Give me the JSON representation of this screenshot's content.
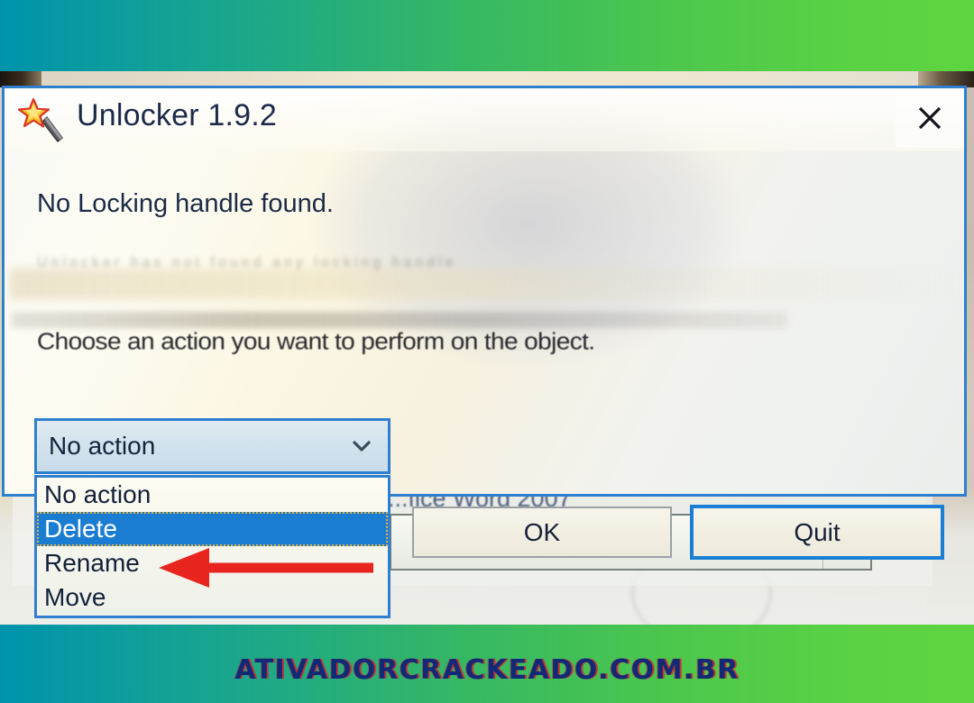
{
  "window": {
    "title": "Unlocker 1.9.2",
    "icon": "magic-wand-icon",
    "close_label": "✕",
    "accent_color": "#2f7fd0"
  },
  "messages": {
    "primary": "No Locking handle found.",
    "ghost_line": "Unlocker has not found any locking handle",
    "instruction": "Choose an action you want to perform on the object."
  },
  "action_combo": {
    "selected": "No action",
    "chevron": "chevron-down-icon",
    "options": [
      {
        "label": "No action",
        "state": "normal"
      },
      {
        "label": "Delete",
        "state": "highlighted"
      },
      {
        "label": "Rename",
        "state": "normal"
      },
      {
        "label": "Move",
        "state": "normal"
      }
    ]
  },
  "buttons": {
    "ok": "OK",
    "quit": "Quit",
    "quit_focus_color": "#1a7fd4"
  },
  "annotation": {
    "arrow": "red-arrow-pointing-left",
    "arrow_color": "#e8241f",
    "points_at": "Rename"
  },
  "background_window": {
    "label": "...fice Word 2007",
    "combo_chevron": "chevron-down-icon"
  },
  "watermark": {
    "text": "ativadorcrackeado.com.br",
    "text_color": "#112a78",
    "shadow_color": "#dc1e28"
  },
  "banner": {
    "gradient_start": "#0093ac",
    "gradient_end": "#5fd441"
  }
}
